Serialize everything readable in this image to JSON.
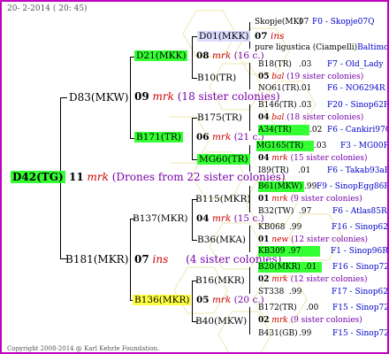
{
  "header": {
    "date": "20-  2-2014 ( 20: 45)"
  },
  "footer": {
    "copyright": "Copyright 2008-2014 @ Karl Kehrle Foundation."
  },
  "root": {
    "code": "D42(TG)",
    "num": "11",
    "mark": "mrk",
    "note": "(Drones from 22 sister colonies)"
  },
  "g1": [
    {
      "code": "D83(MKW)",
      "num": "09",
      "mark": "mrk",
      "note": "(18 sister colonies)"
    },
    {
      "code": "B181(MKR)",
      "num": "07",
      "mark": "ins",
      "note": "(4 sister colonies)"
    }
  ],
  "g2": [
    {
      "code": "D21(MKK)",
      "num": "08",
      "mark": "mrk",
      "note": "(16 c.)"
    },
    {
      "code": "B171(TR)",
      "num": "06",
      "mark": "mrk",
      "note": "(21 c.)"
    },
    {
      "code": "B137(MKR)",
      "num": "04",
      "mark": "mrk",
      "note": "(15 c.)"
    },
    {
      "code": "B136(MKR)",
      "num": "05",
      "mark": "mrk",
      "note": "(20 c.)"
    }
  ],
  "g3": [
    {
      "code": "D01(MKK)"
    },
    {
      "code": "B10(TR)"
    },
    {
      "code": "B175(TR)"
    },
    {
      "code": "MG60(TR)"
    },
    {
      "code": "B115(MKR)"
    },
    {
      "code": "B36(MKA)"
    },
    {
      "code": "B16(MKR)"
    },
    {
      "code": "B40(MKW)"
    }
  ],
  "g4": [
    {
      "code": "Skopje(MK)",
      "year": ".07",
      "ped": "F0 - Skopje07Q"
    },
    {
      "num": "07",
      "mark": "ins"
    },
    {
      "code": "pure ligustica (Ciampelli)",
      "ped": "Baltimore"
    },
    {
      "code": "B18(TR)",
      "year": ".03",
      "ped": "F7 - Old_Lady"
    },
    {
      "num": "05",
      "mark": "bal",
      "note": "(19 sister colonies)"
    },
    {
      "code": "NO61(TR)",
      "year": ".01",
      "ped": "F6 - NO6294R"
    },
    {
      "code": "B146(TR)",
      "year": ".03",
      "ped": "F20 - Sinop62R"
    },
    {
      "num": "04",
      "mark": "bal",
      "note": "(18 sister colonies)"
    },
    {
      "code": "A34(TR)",
      "year": ".02",
      "ped": "F6 - Cankiri97Q"
    },
    {
      "code": "MG165(TR)",
      "year": ".03",
      "ped": "F3 - MG00R"
    },
    {
      "num": "04",
      "mark": "mrk",
      "note": "(15 sister colonies)"
    },
    {
      "code": "I89(TR)",
      "year": ".01",
      "ped": "F6 - Takab93aR"
    },
    {
      "code": "B61(MKW)",
      "year": ".99",
      "ped": "F9 - SinopEgg86R"
    },
    {
      "num": "01",
      "mark": "mrk",
      "note": "(9 sister colonies)"
    },
    {
      "code": "B32(TW)",
      "year": ".97",
      "ped": "F6 - Atlas85R"
    },
    {
      "code": "KB068",
      "year": ".99",
      "ped": "F16 - Sinop62R"
    },
    {
      "num": "01",
      "mark": "new",
      "note": "(12 sister colonies)"
    },
    {
      "code": "KB309",
      "year": ".97",
      "ped": "F1 - Sinop96R"
    },
    {
      "code": "B20(MKR)",
      "year": ".01",
      "ped": "F16 - Sinop72R"
    },
    {
      "num": "02",
      "mark": "mrk",
      "note": "(12 sister colonies)"
    },
    {
      "code": "ST338",
      "year": ".99",
      "ped": "F17 - Sinop62R"
    },
    {
      "code": "B172(TR)",
      "year": ".00",
      "ped": "F15 - Sinop72R"
    },
    {
      "num": "02",
      "mark": "mrk",
      "note": "(9 sister colonies)"
    },
    {
      "code": "B431(GB)",
      "year": ".99",
      "ped": "F15 - Sinop72R"
    }
  ]
}
